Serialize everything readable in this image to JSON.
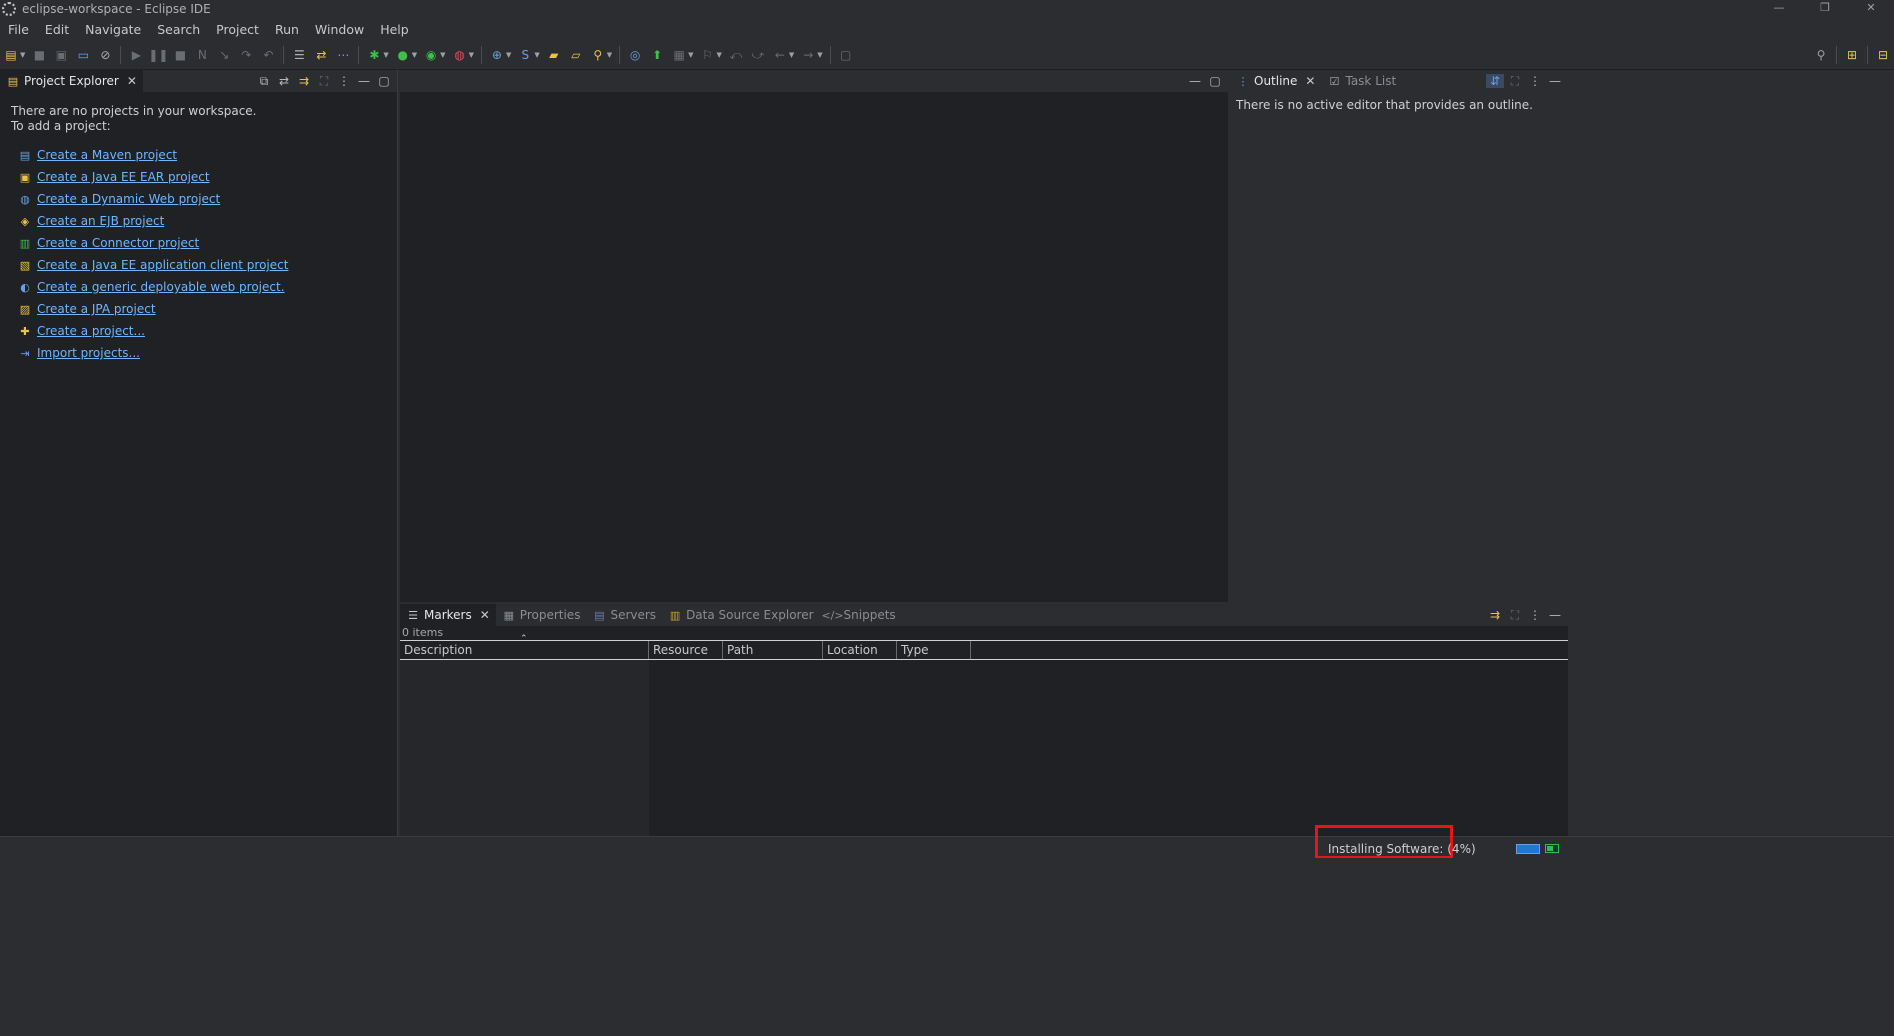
{
  "window": {
    "title": "eclipse-workspace - Eclipse IDE",
    "controls": {
      "minimize": "—",
      "restore": "❐",
      "close": "✕"
    }
  },
  "menu": {
    "items": [
      "File",
      "Edit",
      "Navigate",
      "Search",
      "Project",
      "Run",
      "Window",
      "Help"
    ]
  },
  "project_explorer": {
    "tab_label": "Project Explorer",
    "message_line1": "There are no projects in your workspace.",
    "message_line2": "To add a project:",
    "links": [
      {
        "label": "Create a Maven project",
        "icon": "maven-project-icon"
      },
      {
        "label": "Create a Java EE EAR project",
        "icon": "ear-project-icon"
      },
      {
        "label": "Create a Dynamic Web project",
        "icon": "web-project-icon"
      },
      {
        "label": "Create an EJB project",
        "icon": "ejb-project-icon"
      },
      {
        "label": "Create a Connector project",
        "icon": "connector-project-icon"
      },
      {
        "label": "Create a Java EE application client project",
        "icon": "app-client-project-icon"
      },
      {
        "label": "Create a generic deployable web project.",
        "icon": "deployable-web-project-icon"
      },
      {
        "label": "Create a JPA project",
        "icon": "jpa-project-icon"
      },
      {
        "label": "Create a project...",
        "icon": "new-project-icon"
      },
      {
        "label": "Import projects...",
        "icon": "import-icon"
      }
    ]
  },
  "outline": {
    "tabs": [
      "Outline",
      "Task List"
    ],
    "message": "There is no active editor that provides an outline."
  },
  "bottom_panel": {
    "tabs": [
      "Markers",
      "Properties",
      "Servers",
      "Data Source Explorer",
      "Snippets"
    ],
    "count_text": "0 items",
    "columns": [
      "Description",
      "Resource",
      "Path",
      "Location",
      "Type"
    ]
  },
  "status": {
    "progress_text": "Installing Software: (4%)",
    "progress_percent": 4
  },
  "colors": {
    "link": "#6fb6ff",
    "highlight_box": "#e3161c",
    "progress": "#1e78d6"
  }
}
